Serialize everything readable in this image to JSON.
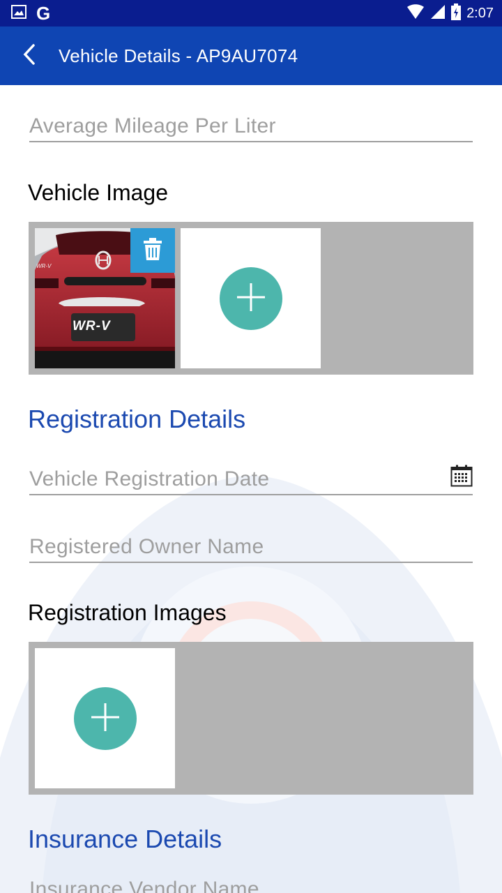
{
  "status_bar": {
    "time": "2:07",
    "icons": [
      "image-notification-icon",
      "google-icon",
      "wifi-icon",
      "signal-icon",
      "battery-charging-icon"
    ]
  },
  "app_bar": {
    "title": "Vehicle Details - AP9AU7074",
    "back_icon": "back-arrow-icon"
  },
  "form": {
    "mileage_placeholder": "Average Mileage Per Liter",
    "vehicle_image_label": "Vehicle Image",
    "registration_heading": "Registration Details",
    "registration_date_placeholder": "Vehicle Registration Date",
    "owner_name_placeholder": "Registered Owner Name",
    "registration_images_label": "Registration Images",
    "insurance_heading": "Insurance Details",
    "insurance_vendor_placeholder": "Insurance Vendor Name"
  },
  "vehicle_photo": {
    "badge_text": "WR-V",
    "small_badge_text": "WR-V"
  },
  "colors": {
    "status_bar": "#0a1d8f",
    "app_bar": "#0f45b3",
    "heading_blue": "#1b49b0",
    "add_button": "#4db6ac",
    "delete_button": "#2c9bd6",
    "strip_gray": "#b3b3b3"
  }
}
